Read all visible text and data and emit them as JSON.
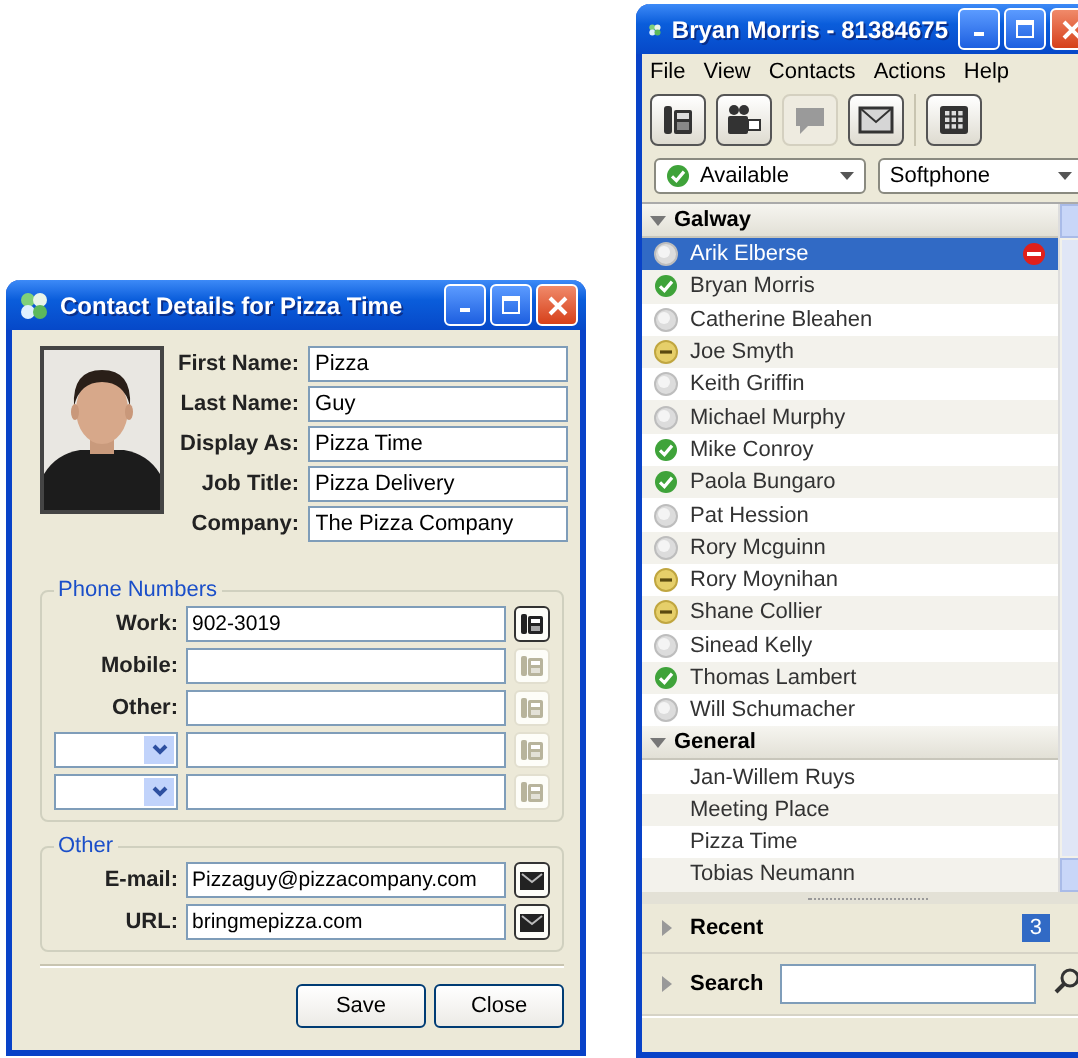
{
  "contact_window": {
    "title": "Contact Details for Pizza Time",
    "fields": [
      {
        "label": "First Name:",
        "value": "Pizza"
      },
      {
        "label": "Last Name:",
        "value": "Guy"
      },
      {
        "label": "Display As:",
        "value": "Pizza Time"
      },
      {
        "label": "Job Title:",
        "value": "Pizza Delivery"
      },
      {
        "label": "Company:",
        "value": "The Pizza Company"
      }
    ],
    "phone_group": {
      "title": "Phone Numbers",
      "rows": [
        {
          "kind": "labeled",
          "label": "Work:",
          "value": "902-3019",
          "disabled": false
        },
        {
          "kind": "labeled",
          "label": "Mobile:",
          "disabled": true
        },
        {
          "kind": "labeled",
          "label": "Other:",
          "disabled": true
        },
        {
          "kind": "dropdown",
          "disabled": true
        },
        {
          "kind": "dropdown",
          "disabled": true
        }
      ]
    },
    "other_group": {
      "title": "Other",
      "rows": [
        {
          "label": "E-mail:",
          "value": "Pizzaguy@pizzacompany.com"
        },
        {
          "label": "URL:",
          "value": "bringmepizza.com"
        }
      ]
    },
    "buttons": [
      "Save",
      "Close"
    ]
  },
  "main_window": {
    "title": "Bryan Morris - 81384675",
    "menu": [
      "File",
      "View",
      "Contacts",
      "Actions",
      "Help"
    ],
    "toolbar": [
      {
        "kind": "phone",
        "disabled": false
      },
      {
        "kind": "video",
        "disabled": false
      },
      {
        "kind": "chat",
        "disabled": true
      },
      {
        "kind": "mail",
        "disabled": false
      },
      {
        "kind": "keypad",
        "disabled": false
      }
    ],
    "presence": {
      "value": "Available",
      "kind": "available"
    },
    "device": {
      "value": "Softphone"
    },
    "groups": [
      {
        "name": "Galway",
        "expanded": true,
        "contacts": [
          {
            "name": "Arik Elberse",
            "kind": "offline",
            "selected": true,
            "dnd": true
          },
          {
            "name": "Bryan Morris",
            "kind": "available",
            "selected": false,
            "dnd": false
          },
          {
            "name": "Catherine Bleahen",
            "kind": "offline",
            "selected": false,
            "dnd": false
          },
          {
            "name": "Joe Smyth",
            "kind": "away",
            "selected": false,
            "dnd": false
          },
          {
            "name": "Keith Griffin",
            "kind": "offline",
            "selected": false,
            "dnd": false
          },
          {
            "name": "Michael Murphy",
            "kind": "offline",
            "selected": false,
            "dnd": false
          },
          {
            "name": "Mike Conroy",
            "kind": "available",
            "selected": false,
            "dnd": false
          },
          {
            "name": "Paola Bungaro",
            "kind": "available",
            "selected": false,
            "dnd": false
          },
          {
            "name": "Pat Hession",
            "kind": "offline",
            "selected": false,
            "dnd": false
          },
          {
            "name": "Rory Mcguinn",
            "kind": "offline",
            "selected": false,
            "dnd": false
          },
          {
            "name": "Rory Moynihan",
            "kind": "away",
            "selected": false,
            "dnd": false
          },
          {
            "name": "Shane Collier",
            "kind": "away",
            "selected": false,
            "dnd": false
          },
          {
            "name": "Sinead Kelly",
            "kind": "offline",
            "selected": false,
            "dnd": false
          },
          {
            "name": "Thomas Lambert",
            "kind": "available",
            "selected": false,
            "dnd": false
          },
          {
            "name": "Will Schumacher",
            "kind": "offline",
            "selected": false,
            "dnd": false
          }
        ]
      },
      {
        "name": "General",
        "expanded": true,
        "contacts": [
          {
            "name": "Jan-Willem Ruys",
            "kind": "none",
            "selected": false,
            "dnd": false
          },
          {
            "name": "Meeting Place",
            "kind": "none",
            "selected": false,
            "dnd": false
          },
          {
            "name": "Pizza Time",
            "kind": "none",
            "selected": false,
            "dnd": false
          },
          {
            "name": "Tobias Neumann",
            "kind": "none",
            "selected": false,
            "dnd": false
          }
        ]
      }
    ],
    "recent": {
      "label": "Recent",
      "expanded": false,
      "count": "3"
    },
    "search": {
      "label": "Search",
      "expanded": false
    }
  }
}
